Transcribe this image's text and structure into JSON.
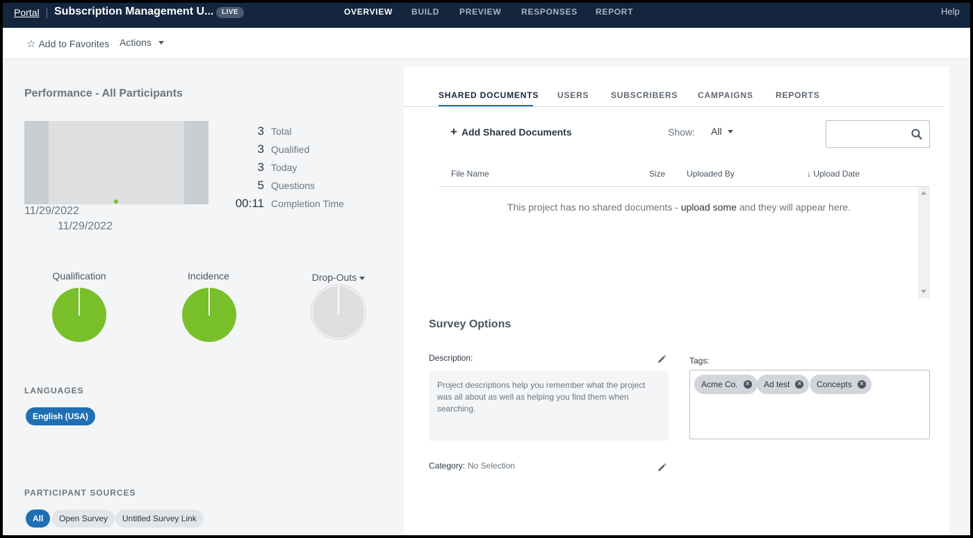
{
  "topbar": {
    "portal": "Portal",
    "project_title": "Subscription Management U...",
    "status_badge": "LIVE",
    "nav": [
      "OVERVIEW",
      "BUILD",
      "PREVIEW",
      "RESPONSES",
      "REPORT"
    ],
    "active_nav": "OVERVIEW",
    "help": "Help"
  },
  "actionbar": {
    "favorites": "Add to Favorites",
    "actions": "Actions"
  },
  "performance": {
    "title": "Performance - All Participants",
    "date_start": "11/29/2022",
    "date_end": "11/29/2022",
    "stats": [
      {
        "value": "3",
        "label": "Total"
      },
      {
        "value": "3",
        "label": "Qualified"
      },
      {
        "value": "3",
        "label": "Today"
      },
      {
        "value": "5",
        "label": "Questions"
      },
      {
        "value": "00:11",
        "label": "Completion Time"
      }
    ],
    "gauges": {
      "qualification": "Qualification",
      "incidence": "Incidence",
      "dropouts": "Drop-Outs"
    }
  },
  "languages": {
    "heading": "LANGUAGES",
    "items": [
      "English (USA)"
    ]
  },
  "sources": {
    "heading": "PARTICIPANT SOURCES",
    "items": [
      "All",
      "Open Survey",
      "Untitled Survey Link"
    ]
  },
  "tabs": [
    "SHARED DOCUMENTS",
    "USERS",
    "SUBSCRIBERS",
    "CAMPAIGNS",
    "REPORTS"
  ],
  "shared_docs": {
    "add_label": "Add Shared Documents",
    "show_label": "Show:",
    "show_value": "All",
    "search_placeholder": "",
    "columns": [
      "File Name",
      "Size",
      "Uploaded By",
      "Upload Date"
    ],
    "sort_indicator": "↓",
    "empty_pre": "This project has no shared documents - ",
    "empty_link": "upload some",
    "empty_post": " and they will appear here."
  },
  "survey_options": {
    "title": "Survey Options",
    "description_label": "Description:",
    "description_placeholder": "Project descriptions help you remember what the project was all about as well as helping you find them when searching.",
    "tags_label": "Tags:",
    "tags": [
      "Acme Co.",
      "Ad test",
      "Concepts"
    ],
    "category_label": "Category:",
    "category_value": "No Selection"
  },
  "colors": {
    "topbar": "#14253e",
    "accent_blue": "#1f6fb5",
    "gauge_green": "#79bf2a"
  }
}
